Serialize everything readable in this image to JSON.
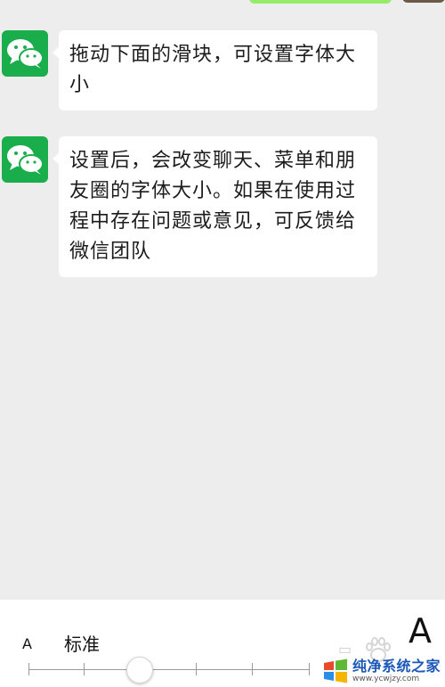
{
  "messages": [
    {
      "sender": "wechat-team",
      "text": "拖动下面的滑块，可设置字体大小"
    },
    {
      "sender": "wechat-team",
      "text": "设置后，会改变聊天、菜单和朋友圈的字体大小。如果在使用过程中存在问题或意见，可反馈给微信团队"
    }
  ],
  "font_panel": {
    "small_label": "A",
    "current_label": "标准",
    "large_label": "A",
    "level_index": 1,
    "level_count": 7
  },
  "watermark": {
    "title": "纯净系统之家",
    "url": "www.ycwjzy.com"
  },
  "colors": {
    "background": "#ededed",
    "bubble": "#ffffff",
    "avatar": "#1aad4b",
    "own_bubble": "#95ec69",
    "watermark_blue": "#1a57b8"
  },
  "icons": {
    "avatar": "wechat-logo-icon",
    "decoration": "paw-icon"
  }
}
